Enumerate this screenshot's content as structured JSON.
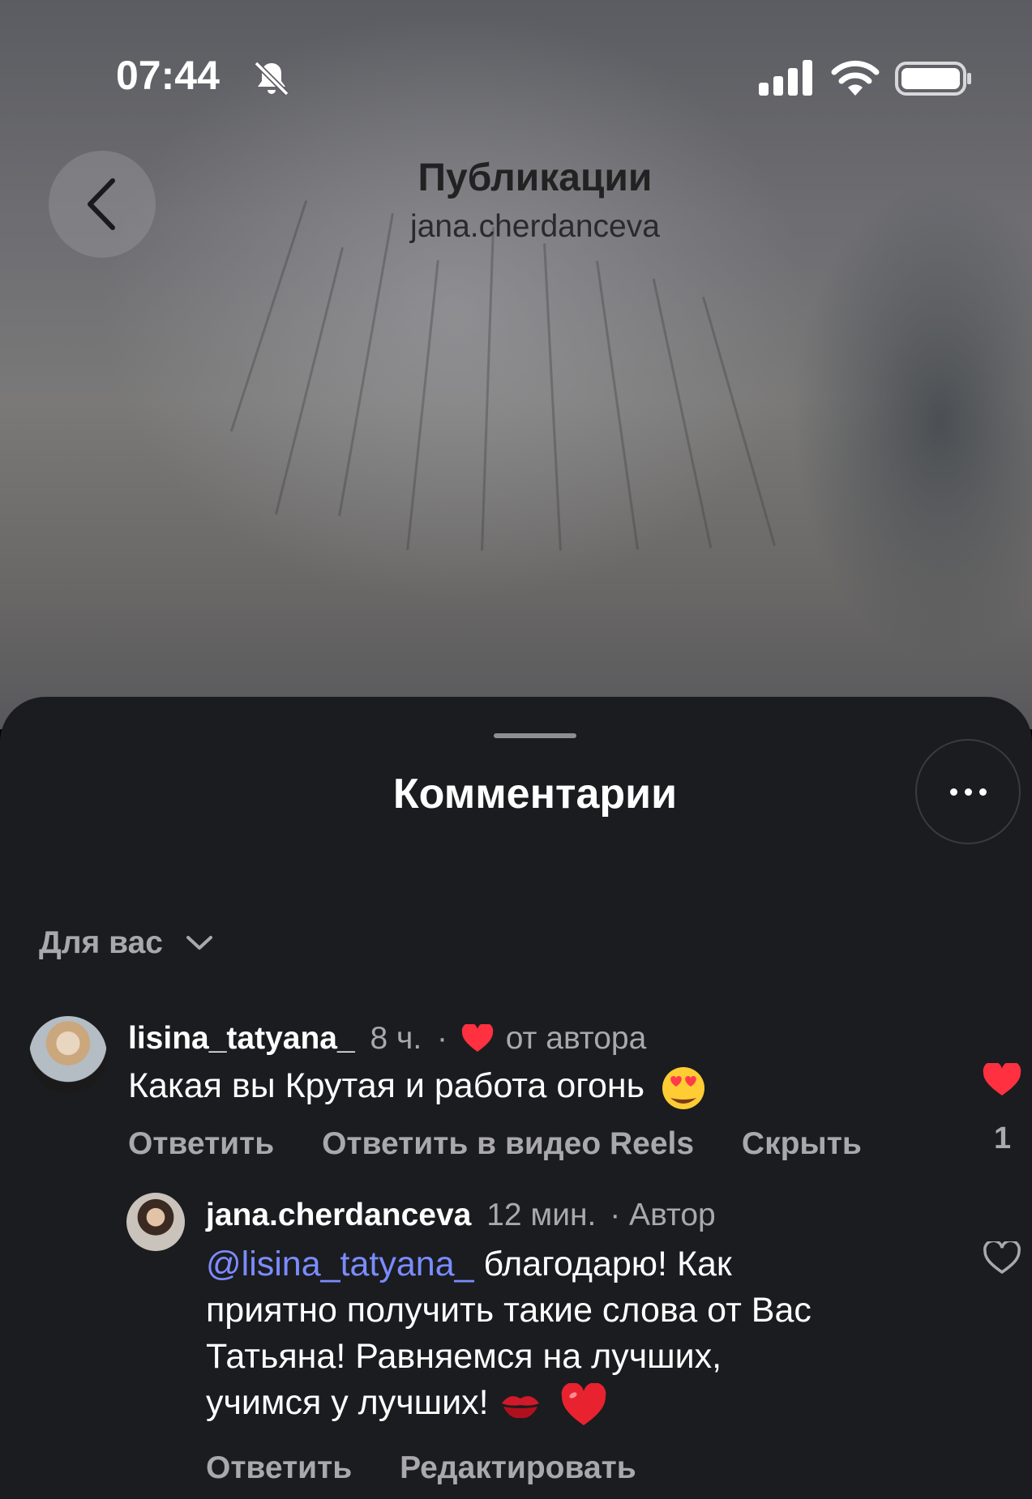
{
  "status_bar": {
    "time": "07:44",
    "icons": [
      "bell-slash-icon",
      "signal-icon",
      "wifi-icon",
      "battery-icon"
    ]
  },
  "header": {
    "title": "Публикации",
    "subtitle": "jana.cherdanceva",
    "back_icon": "chevron-left-icon"
  },
  "comments_sheet": {
    "title": "Комментарии",
    "more_icon": "ellipsis-icon",
    "filter_label": "Для вас",
    "comments": [
      {
        "username": "lisina_tatyana_",
        "time": "8 ч.",
        "separator": "·",
        "badge": "от автора",
        "text": "Какая вы Крутая и работа огонь",
        "emoji": "heart-eyes-emoji",
        "actions": [
          "Ответить",
          "Ответить в видео Reels",
          "Скрыть"
        ],
        "liked": true,
        "like_count": "1"
      },
      {
        "username": "jana.cherdanceva",
        "time": "12 мин.",
        "role": "· Автор",
        "mention": "@lisina_tatyana_",
        "text_line1": " благодарю! Как",
        "text_line2": "приятно получить такие слова от Вас",
        "text_line3": "Татьяна! Равняемся на лучших,",
        "text_line4": "учимся у лучших!",
        "emojis": [
          "kiss-mark-emoji",
          "red-heart-emoji"
        ],
        "actions": [
          "Ответить",
          "Редактировать"
        ],
        "liked": false
      }
    ]
  },
  "colors": {
    "sheet_bg": "#1b1c20",
    "secondary_text": "#a8a8ad",
    "mention": "#7b8cff",
    "like_red": "#ff3040"
  }
}
